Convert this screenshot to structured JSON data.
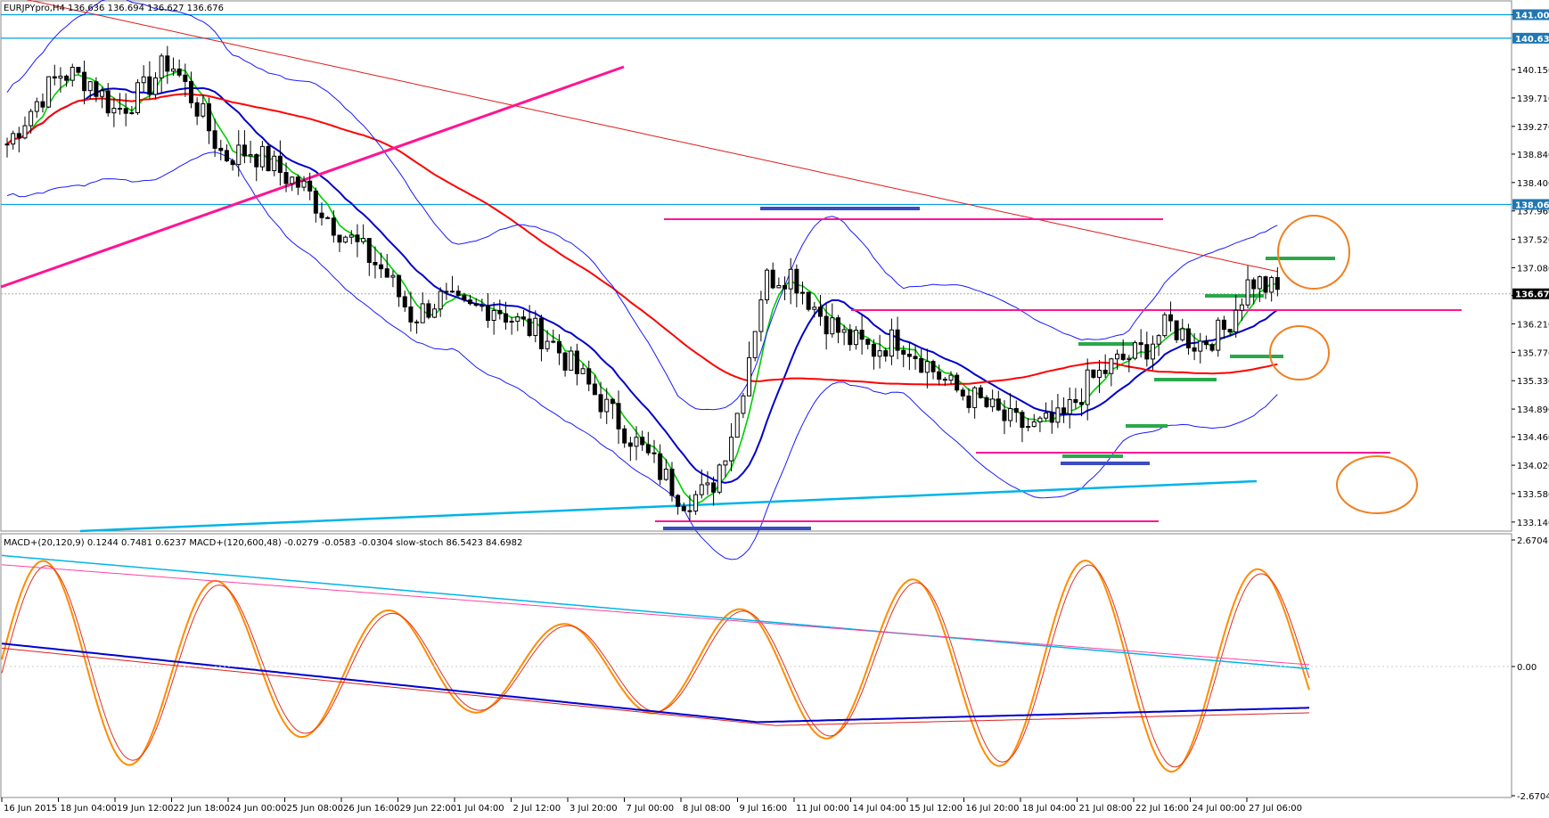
{
  "symbol_header": "EURJPYpro,H4  136.636 136.694 136.627 136.676",
  "indicator_header": "MACD+(20,120,9) 0.1244 0.7481 0.6237  MACD+(120,600,48) -0.0279 -0.0583 -0.0304  slow-stoch 86.5423 84.6982",
  "price_axis": [
    "141.000",
    "140.150",
    "139.710",
    "139.270",
    "138.840",
    "138.400",
    "137.960",
    "137.520",
    "137.080",
    "136.650",
    "136.210",
    "135.770",
    "135.330",
    "134.890",
    "134.460",
    "134.020",
    "133.580",
    "133.140"
  ],
  "price_tags": {
    "top": "141.003",
    "upper": "140.636",
    "mid": "138.060",
    "current": "136.676"
  },
  "indicator_axis": [
    "2.6704",
    "0.00",
    "-2.6704"
  ],
  "time_axis": [
    "16 Jun 2015",
    "18 Jun 04:00",
    "19 Jun 12:00",
    "22 Jun 18:00",
    "24 Jun 00:00",
    "25 Jun 08:00",
    "26 Jun 16:00",
    "29 Jun 22:00",
    "1 Jul 04:00",
    "2 Jul 12:00",
    "3 Jul 20:00",
    "7 Jul 00:00",
    "8 Jul 08:00",
    "9 Jul 16:00",
    "11 Jul 00:00",
    "14 Jul 04:00",
    "15 Jul 12:00",
    "16 Jul 20:00",
    "18 Jul 04:00",
    "21 Jul 08:00",
    "22 Jul 16:00",
    "24 Jul 00:00",
    "27 Jul 06:00"
  ],
  "colors": {
    "bollinger": "#1a1aff",
    "ma_fast": "#00cc00",
    "ma_mid": "#0000cc",
    "ma_slow": "#ff0000",
    "ma_long": "#00aaee",
    "trend": "#ff1493",
    "support": "#3a4cc0",
    "zone": "#2aa84a",
    "circle": "#f08020",
    "tag_bg": "#1f77b4",
    "stoch": "#ff8c00"
  }
}
